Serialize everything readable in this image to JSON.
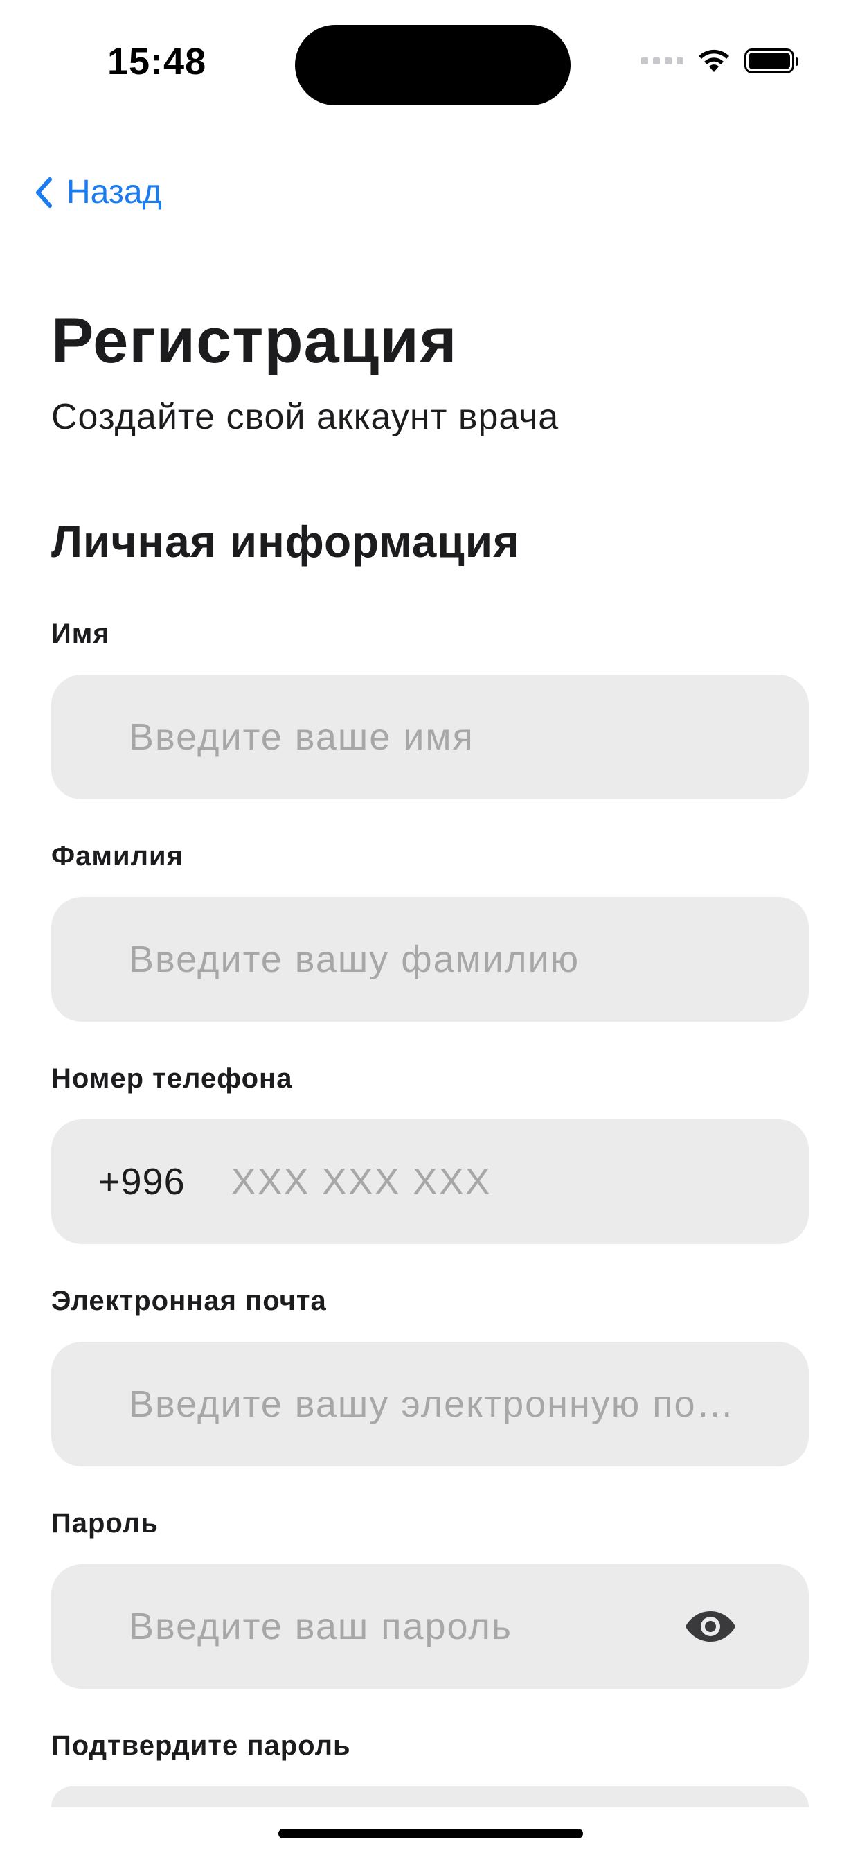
{
  "status_bar": {
    "time": "15:48"
  },
  "nav": {
    "back_label": "Назад"
  },
  "header": {
    "title": "Регистрация",
    "subtitle": "Создайте свой аккаунт врача"
  },
  "section": {
    "title": "Личная информация"
  },
  "form": {
    "first_name": {
      "label": "Имя",
      "placeholder": "Введите ваше имя",
      "value": ""
    },
    "last_name": {
      "label": "Фамилия",
      "placeholder": "Введите вашу фамилию",
      "value": ""
    },
    "phone": {
      "label": "Номер телефона",
      "prefix": "+996",
      "placeholder": "XXX XXX XXX",
      "value": ""
    },
    "email": {
      "label": "Электронная почта",
      "placeholder": "Введите вашу электронную по…",
      "value": ""
    },
    "password": {
      "label": "Пароль",
      "placeholder": "Введите ваш пароль",
      "value": ""
    },
    "confirm_password": {
      "label": "Подтвердите пароль"
    }
  },
  "icons": {
    "back": "chevron-left-icon",
    "password_toggle": "eye-icon"
  },
  "colors": {
    "accent": "#1a7cf0",
    "field_background": "#ebebeb",
    "placeholder": "#a7a7a7",
    "text": "#1c1c1e"
  }
}
